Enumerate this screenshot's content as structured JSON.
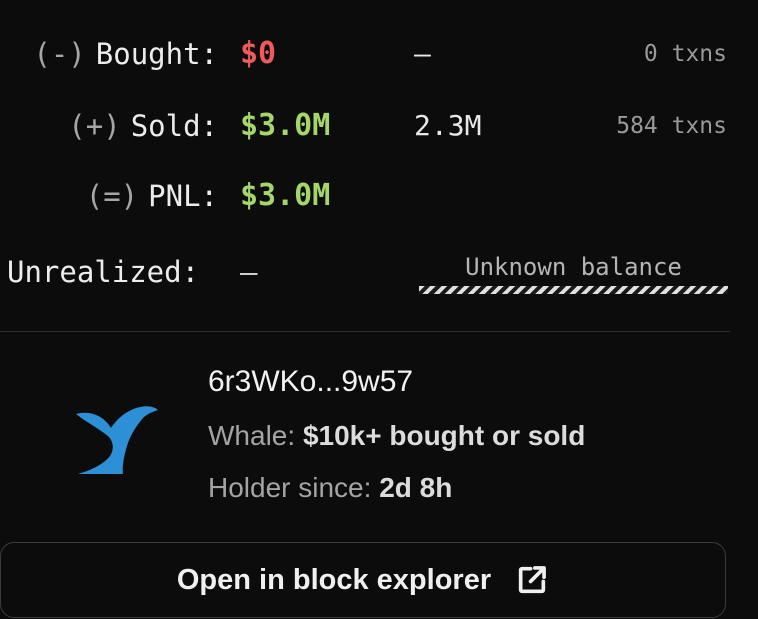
{
  "stats": {
    "bought": {
      "sign": "(-)",
      "label": "Bought:",
      "value": "$0",
      "amount": "–",
      "txns": "0 txns"
    },
    "sold": {
      "sign": "(+)",
      "label": "Sold:",
      "value": "$3.0M",
      "amount": "2.3M",
      "txns": "584 txns"
    },
    "pnl": {
      "sign": "(=)",
      "label": "PNL:",
      "value": "$3.0M"
    },
    "unrealized": {
      "label": "Unrealized:",
      "value": "–",
      "balance_status": "Unknown balance"
    }
  },
  "holder": {
    "icon": "whale-tail-icon",
    "address": "6r3WKo...9w57",
    "whale_label": "Whale:",
    "whale_value": "$10k+ bought or sold",
    "since_label": "Holder since:",
    "since_value": "2d 8h"
  },
  "explorer_button": {
    "label": "Open in block explorer",
    "icon": "external-link-icon"
  },
  "colors": {
    "background": "#0c0c0c",
    "negative": "#ef5b5b",
    "positive": "#a5d66a",
    "whale_icon": "#2d8fd5"
  }
}
